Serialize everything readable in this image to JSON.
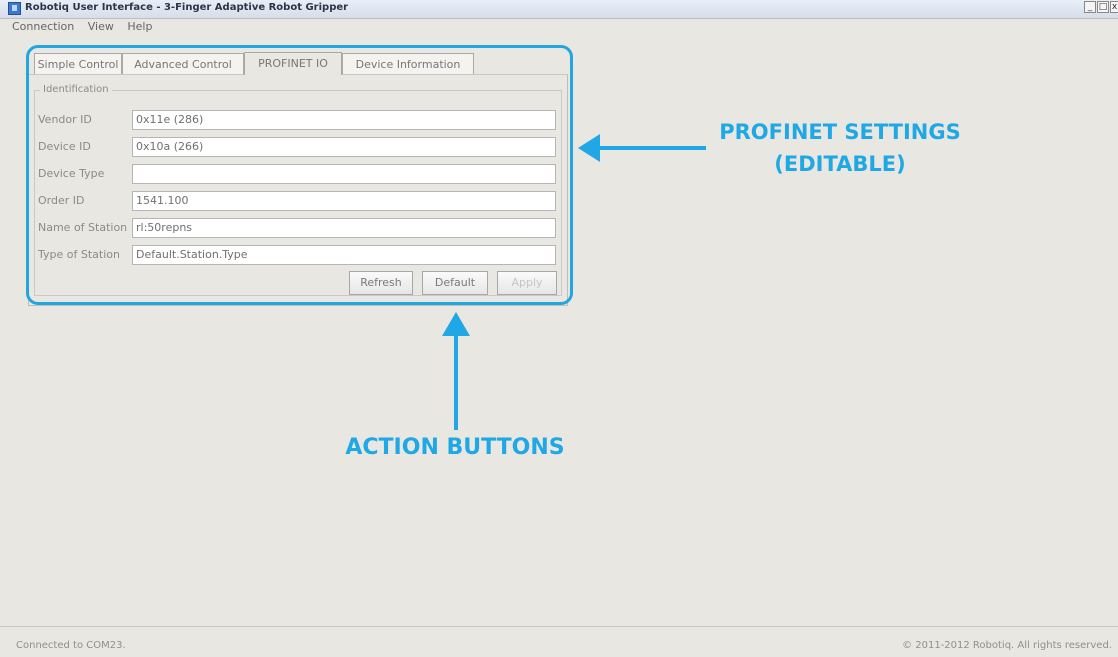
{
  "window": {
    "title": "Robotiq User Interface - 3-Finger Adaptive Robot Gripper",
    "controls": [
      "_",
      "□",
      "x"
    ]
  },
  "menu": [
    "Connection",
    "View",
    "Help"
  ],
  "tabs": [
    {
      "label": "Simple Control"
    },
    {
      "label": "Advanced Control"
    },
    {
      "label": "PROFINET IO"
    },
    {
      "label": "Device Information"
    }
  ],
  "identification": {
    "title": "Identification",
    "fields": [
      {
        "label": "Vendor ID",
        "value": "0x11e (286)"
      },
      {
        "label": "Device ID",
        "value": "0x10a (266)"
      },
      {
        "label": "Device Type",
        "value": ""
      },
      {
        "label": "Order ID",
        "value": "1541.100"
      },
      {
        "label": "Name of Station",
        "value": "rl:50repns"
      },
      {
        "label": "Type of Station",
        "value": "Default.Station.Type"
      }
    ]
  },
  "buttons": {
    "refresh": "Refresh",
    "default": "Default",
    "apply": "Apply"
  },
  "annotations": {
    "profinet_line1": "PROFINET SETTINGS",
    "profinet_line2": "(EDITABLE)",
    "action": "ACTION BUTTONS",
    "color": "#1fa8e5"
  },
  "status": {
    "left": "Connected to COM23.",
    "right": "© 2011-2012 Robotiq. All rights reserved."
  }
}
